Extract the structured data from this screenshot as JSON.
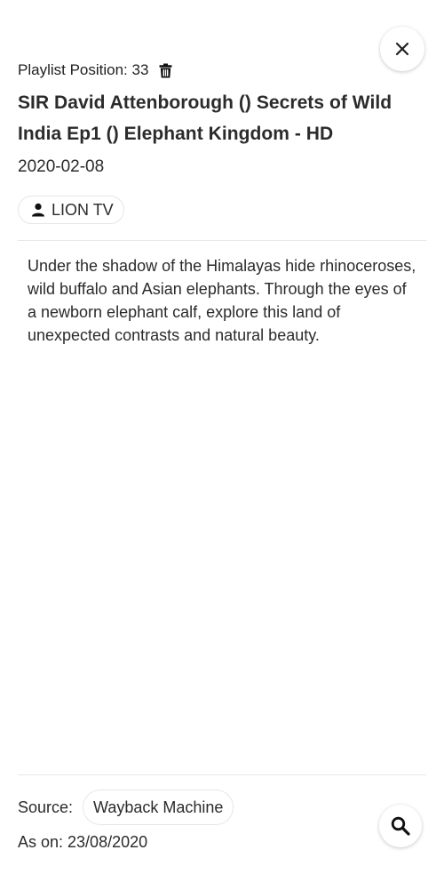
{
  "header": {
    "playlist_position_label": "Playlist Position: 33",
    "close_icon": "close-icon",
    "delete_icon": "trash-icon"
  },
  "video": {
    "title": "SIR David Attenborough () Secrets of Wild India Ep1 () Elephant Kingdom - HD",
    "date": "2020-02-08",
    "channel": "LION TV",
    "channel_icon": "person-icon",
    "description": "Under the shadow of the Himalayas hide rhinoceroses, wild buffalo and Asian elephants. Through the eyes of a newborn elephant calf, explore this land of unexpected contrasts and natural beauty."
  },
  "footer": {
    "source_label": "Source:",
    "source_value": "Wayback Machine",
    "as_on": "As on: 23/08/2020",
    "search_icon": "search-icon"
  }
}
